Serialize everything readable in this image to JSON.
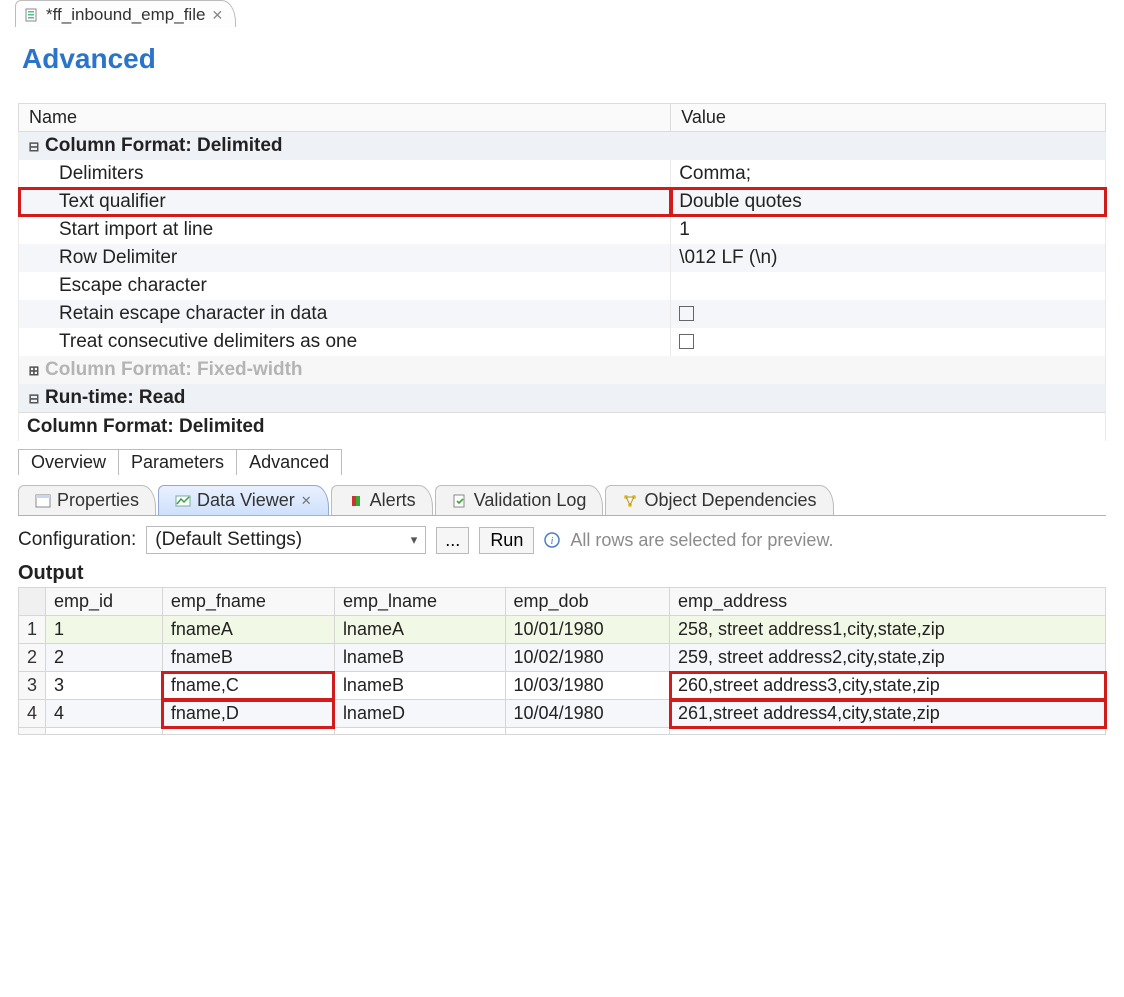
{
  "editor": {
    "tab_title": "*ff_inbound_emp_file"
  },
  "section": {
    "title": "Advanced"
  },
  "propHeaders": {
    "name": "Name",
    "value": "Value"
  },
  "groups": {
    "delimited": "Column Format: Delimited",
    "fixedwidth": "Column Format: Fixed-width",
    "runtime": "Run-time: Read",
    "footer": "Column Format: Delimited"
  },
  "props": {
    "delimiters": {
      "label": "Delimiters",
      "value": "Comma;"
    },
    "text_qualifier": {
      "label": "Text qualifier",
      "value": "Double quotes"
    },
    "start_line": {
      "label": "Start import at line",
      "value": "1"
    },
    "row_delim": {
      "label": "Row Delimiter",
      "value": "\\012 LF (\\n)"
    },
    "escape_char": {
      "label": "Escape character",
      "value": ""
    },
    "retain_escape": {
      "label": "Retain escape character in data"
    },
    "treat_consec": {
      "label": "Treat consecutive delimiters as one"
    }
  },
  "pageTabs": {
    "overview": "Overview",
    "parameters": "Parameters",
    "advanced": "Advanced"
  },
  "viewTabs": {
    "properties": "Properties",
    "dataviewer": "Data Viewer",
    "alerts": "Alerts",
    "validation": "Validation Log",
    "objdep": "Object Dependencies"
  },
  "config": {
    "label": "Configuration:",
    "selected": "(Default Settings)",
    "ellipsis": "...",
    "run": "Run",
    "hint": "All rows are selected for preview."
  },
  "output": {
    "title": "Output",
    "columns": [
      "emp_id",
      "emp_fname",
      "emp_lname",
      "emp_dob",
      "emp_address"
    ],
    "rows": [
      [
        "1",
        "fnameA",
        "lnameA",
        "10/01/1980",
        "258, street address1,city,state,zip"
      ],
      [
        "2",
        "fnameB",
        "lnameB",
        "10/02/1980",
        "259, street address2,city,state,zip"
      ],
      [
        "3",
        "fname,C",
        "lnameB",
        "10/03/1980",
        "260,street address3,city,state,zip"
      ],
      [
        "4",
        "fname,D",
        "lnameD",
        "10/04/1980",
        "261,street address4,city,state,zip"
      ]
    ]
  }
}
